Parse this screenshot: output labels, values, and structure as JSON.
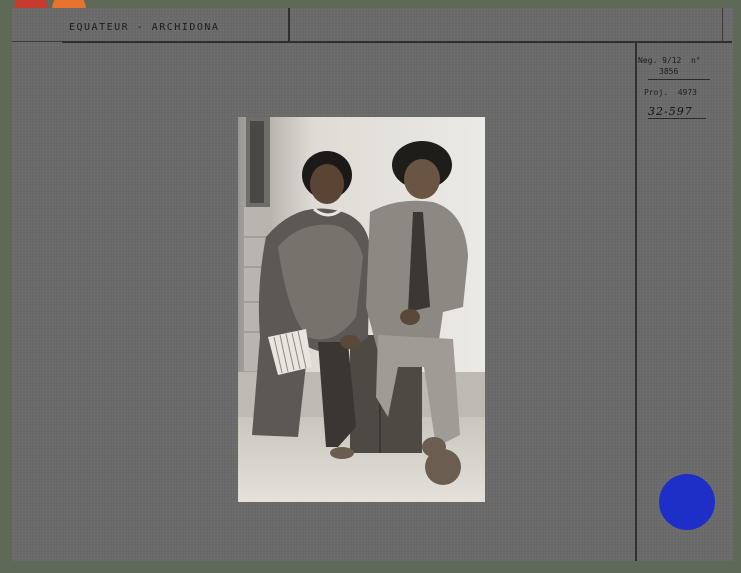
{
  "header": {
    "location": "EQUATEUR - ARCHIDONA"
  },
  "meta": {
    "neg": "Neg. 9/12  n°",
    "neg_number": "3856",
    "proj": "Proj.  4973",
    "code": "32-597"
  },
  "colors": {
    "card_background": "#686868",
    "page_background": "#5e6a57",
    "dot_red": "#c73b2e",
    "dot_orange": "#e6742f",
    "dot_blue": "#1e2fc7"
  }
}
